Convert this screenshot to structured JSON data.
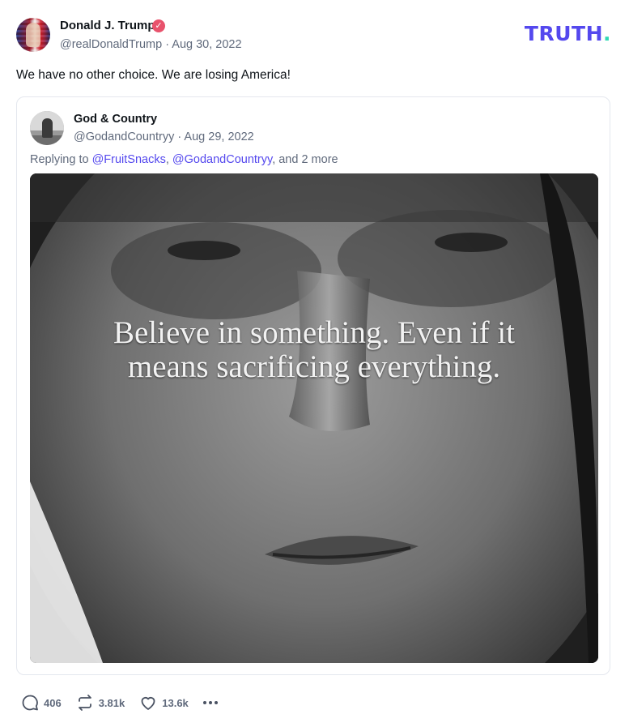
{
  "post": {
    "author_name": "Donald J. Trump",
    "author_meta": "@realDonaldTrump · Aug 30, 2022",
    "text": "We have no other choice. We are losing America!",
    "verified_icon": "verified-badge-icon"
  },
  "brand": {
    "logo_text": "TRUTH",
    "logo_dot": ".",
    "logo_color": "#5448ee",
    "dot_color": "#2fd9b3"
  },
  "quote": {
    "author_name": "God & Country",
    "author_meta": "@GodandCountryy · Aug 29, 2022",
    "replying_prefix": "Replying to ",
    "mention_1": "@FruitSnacks",
    "separator": ", ",
    "mention_2": "@GodandCountryy",
    "replying_suffix": ", and 2 more",
    "image_caption_line1": "Believe in something. Even if it",
    "image_caption_line2": "means sacrificing everything."
  },
  "actions": {
    "replies": "406",
    "retruths": "3.81k",
    "likes": "13.6k"
  },
  "colors": {
    "accent": "#5448ee",
    "muted_text": "#606a7c",
    "verified": "#e8526c"
  }
}
